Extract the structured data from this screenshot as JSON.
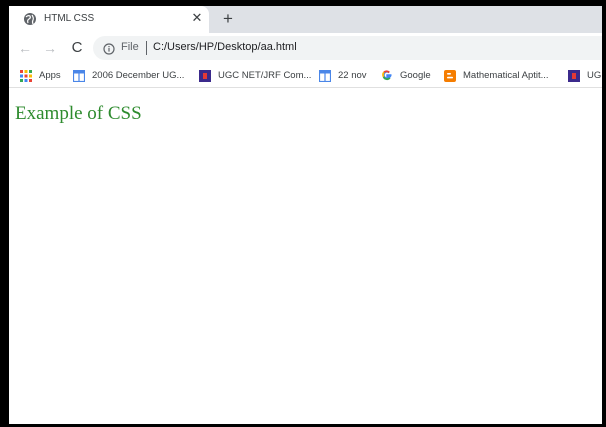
{
  "tab": {
    "title": "HTML CSS",
    "favicon": "globe-icon",
    "close_glyph": "✕",
    "new_tab_glyph": "+"
  },
  "toolbar": {
    "back_glyph": "←",
    "forward_glyph": "→",
    "reload_glyph": "C",
    "omnibox": {
      "security_icon": "info-icon",
      "file_label": "File",
      "url": "C:/Users/HP/Desktop/aa.html"
    }
  },
  "bookmarks": [
    {
      "label": "Apps",
      "icon": "apps-grid-icon"
    },
    {
      "label": "2006 December UG...",
      "icon": "blue-doc-icon"
    },
    {
      "label": "UGC NET/JRF Com...",
      "icon": "purple-site-icon"
    },
    {
      "label": "22 nov",
      "icon": "blue-doc-icon"
    },
    {
      "label": "Google",
      "icon": "google-g-icon"
    },
    {
      "label": "Mathematical Aptit...",
      "icon": "blogger-icon"
    },
    {
      "label": "UG",
      "icon": "purple-site-icon"
    }
  ],
  "page": {
    "heading": "Example of CSS",
    "heading_color": "#2e8b2e"
  }
}
